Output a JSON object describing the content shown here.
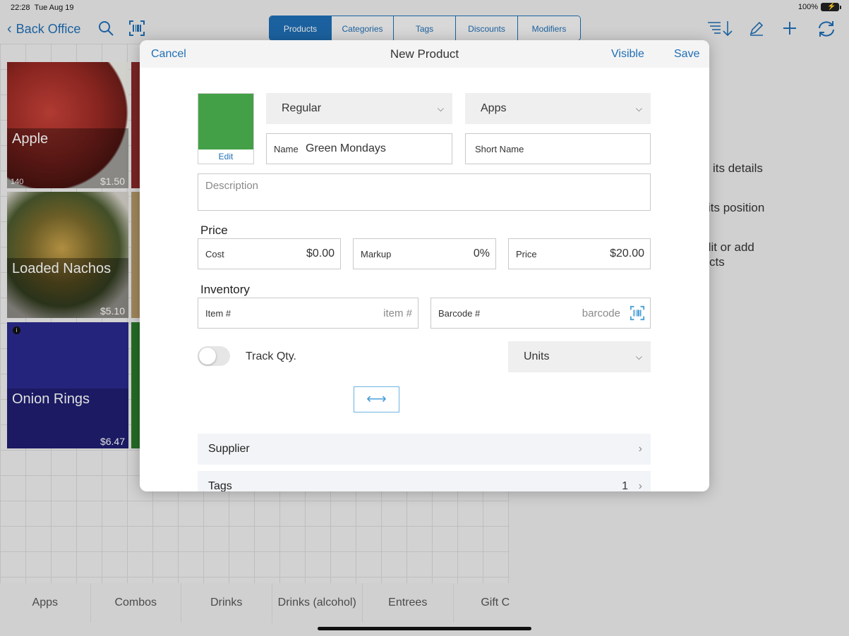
{
  "status": {
    "time": "22:28",
    "date": "Tue Aug 19",
    "battery": "100%"
  },
  "navbar": {
    "back_label": "Back Office"
  },
  "top_tabs": [
    {
      "label": "Products",
      "active": true
    },
    {
      "label": "Categories",
      "active": false
    },
    {
      "label": "Tags",
      "active": false
    },
    {
      "label": "Discounts",
      "active": false
    },
    {
      "label": "Modifiers",
      "active": false
    }
  ],
  "tiles": [
    {
      "name": "Apple",
      "count": "140",
      "price": "$1.50"
    },
    {
      "name": "Loaded Nachos",
      "count": "",
      "price": "$5.10"
    },
    {
      "name": "Onion Rings",
      "count": "",
      "price": "$6.47"
    }
  ],
  "side_hints": [
    "its details",
    "its position",
    "dit or add",
    "cts"
  ],
  "bottom_tabs": [
    "Apps",
    "Combos",
    "Drinks",
    "Drinks (alcohol)",
    "Entrees",
    "Gift Ca"
  ],
  "modal": {
    "title": "New Product",
    "cancel": "Cancel",
    "visible": "Visible",
    "save": "Save",
    "color": "#43a047",
    "edit_label": "Edit",
    "type_select": "Regular",
    "category_select": "Apps",
    "name_label": "Name",
    "name_value": "Green Mondays",
    "short_name_label": "Short Name",
    "description_placeholder": "Description",
    "price_section": "Price",
    "cost_label": "Cost",
    "cost_value": "$0.00",
    "markup_label": "Markup",
    "markup_value": "0%",
    "price_label": "Price",
    "price_value": "$20.00",
    "inventory_section": "Inventory",
    "item_label": "Item #",
    "item_placeholder": "item #",
    "barcode_label": "Barcode #",
    "barcode_placeholder": "barcode",
    "track_qty_label": "Track Qty.",
    "track_qty_on": false,
    "units_select": "Units",
    "supplier_label": "Supplier",
    "tags_label": "Tags",
    "tags_count": "1"
  }
}
